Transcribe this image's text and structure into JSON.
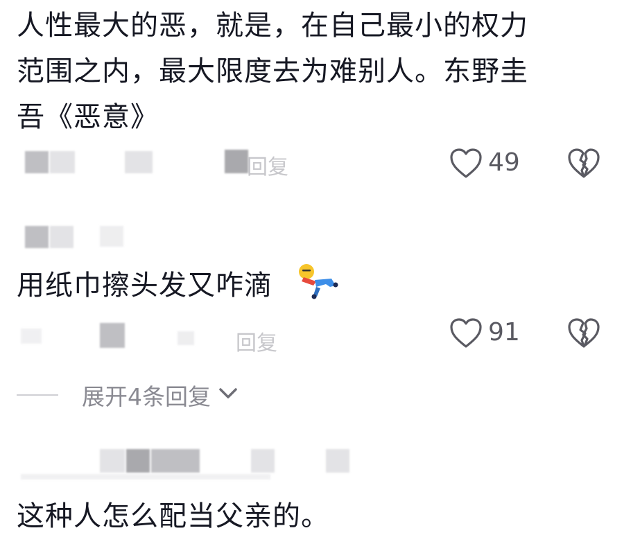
{
  "comments": [
    {
      "text_lines": [
        "人性最大的恶，就是，在自己最小的权力",
        "范围之内，最大限度去为难别人。东野圭",
        "吾《恶意》"
      ],
      "reply_label": "回复",
      "like_count": "49"
    },
    {
      "text": "用纸巾擦头发又咋滴",
      "reply_label": "回复",
      "like_count": "91",
      "expand_label": "展开4条回复"
    },
    {
      "text": "这种人怎么配当父亲的。"
    }
  ],
  "icons": {
    "like": "heart-outline-icon",
    "dislike": "broken-heart-icon",
    "emoji": "lying-person-emoji",
    "chevron": "chevron-down-icon"
  },
  "colors": {
    "text": "#161823",
    "meta": "#9a9aa2",
    "icon": "#5a5a62"
  }
}
